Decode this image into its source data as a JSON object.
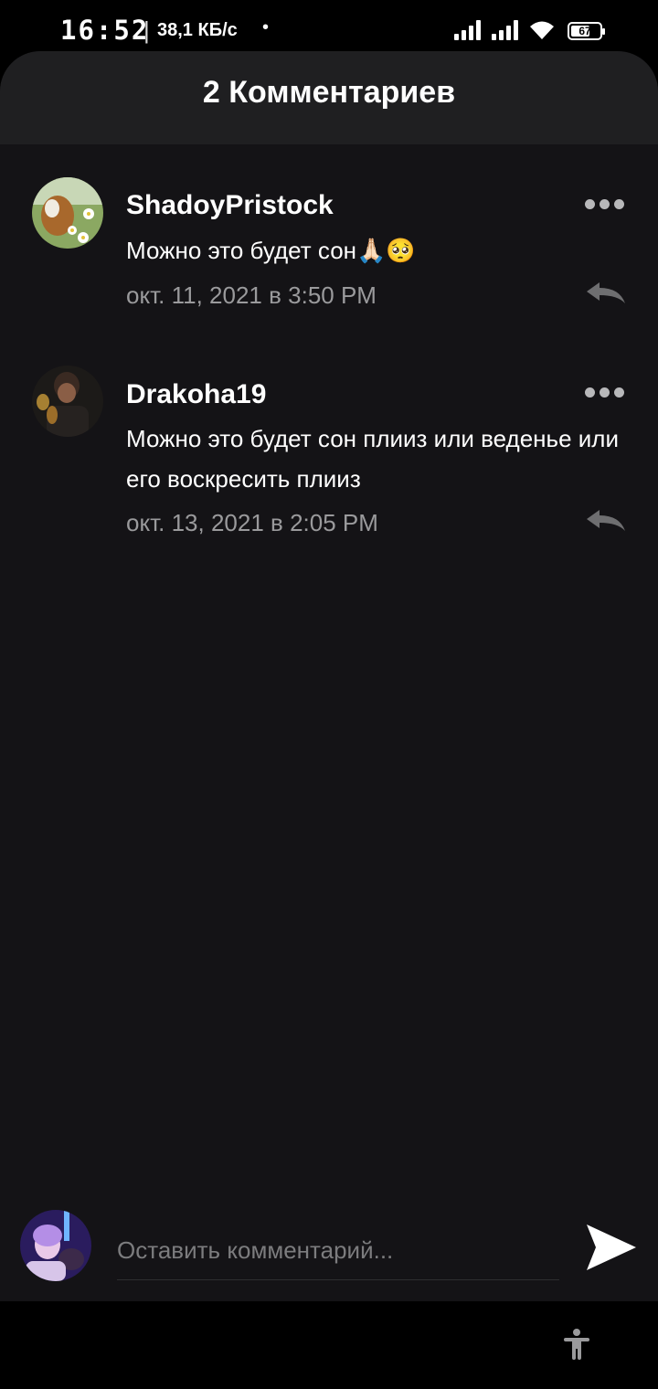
{
  "status_bar": {
    "time": "16:52",
    "separator": "|",
    "speed": "38,1 КБ/с",
    "dot": "•",
    "battery": "67",
    "battery_level": 0.67
  },
  "header": {
    "title": "2 Комментариев"
  },
  "comments": [
    {
      "username": "ShadoyPristock",
      "text": "Можно это будет сон🙏🏻🥺",
      "date": "окт. 11, 2021 в 3:50 PM"
    },
    {
      "username": "Drakoha19",
      "text": "Можно это будет  сон плииз или веденье или его воскресить плииз",
      "date": "окт. 13, 2021 в 2:05 PM"
    }
  ],
  "composer": {
    "placeholder": "Оставить комментарий..."
  },
  "icons": {
    "more": "more-horizontal-icon",
    "reply": "reply-icon",
    "send": "send-icon",
    "accessibility": "accessibility-icon"
  },
  "colors": {
    "background": "#141316",
    "header": "#1f1f21",
    "secondary_text": "#9a9a9c"
  }
}
